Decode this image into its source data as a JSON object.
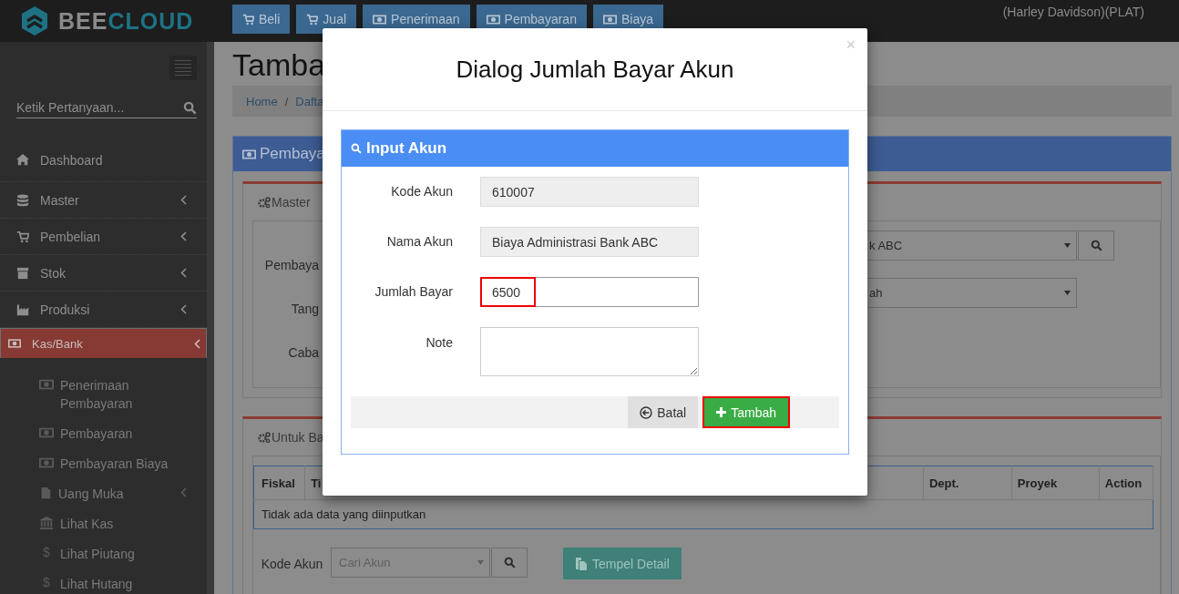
{
  "header": {
    "logo": {
      "part1": "BEE",
      "part2": "CLOUD"
    },
    "nav": [
      {
        "label": "Beli"
      },
      {
        "label": "Jual"
      },
      {
        "label": "Penerimaan"
      },
      {
        "label": "Pembayaran"
      },
      {
        "label": "Biaya"
      }
    ],
    "user": "(Harley Davidson)(PLAT)"
  },
  "sidebar": {
    "search": {
      "placeholder": "Ketik Pertanyaan..."
    },
    "items": [
      {
        "label": "Dashboard",
        "has_submenu": false,
        "selected": false
      },
      {
        "label": "Master",
        "has_submenu": true,
        "selected": false
      },
      {
        "label": "Pembelian",
        "has_submenu": true,
        "selected": false
      },
      {
        "label": "Stok",
        "has_submenu": true,
        "selected": false
      },
      {
        "label": "Produksi",
        "has_submenu": true,
        "selected": false
      },
      {
        "label": "Kas/Bank",
        "has_submenu": true,
        "selected": true
      }
    ],
    "submenu": [
      {
        "label": "Penerimaan Pembayaran",
        "has_submenu": false
      },
      {
        "label": "Pembayaran",
        "has_submenu": false
      },
      {
        "label": "Pembayaran Biaya",
        "has_submenu": false
      },
      {
        "label": "Uang Muka",
        "has_submenu": true
      },
      {
        "label": "Lihat Kas",
        "has_submenu": false
      },
      {
        "label": "Lihat Piutang",
        "symbol": "$",
        "has_submenu": false
      },
      {
        "label": "Lihat Hutang",
        "symbol": "$",
        "has_submenu": false
      }
    ]
  },
  "page": {
    "title": "Tamba",
    "breadcrumb": [
      "Home",
      "/",
      "Dafta"
    ],
    "panel_title": "Pembaya",
    "master_tab": "Master",
    "master_labels": [
      "Pembaya",
      "Tang",
      "Caba"
    ],
    "master_selects": [
      "k ABC",
      "ah"
    ],
    "detail_tab": "Untuk Ba",
    "table": {
      "columns": [
        "Fiskal",
        "Ti",
        "Dept.",
        "Proyek",
        "Action"
      ],
      "empty_text": "Tidak ada data yang diinputkan"
    },
    "kode_akun_label": "Kode Akun",
    "kode_akun_placeholder": "Cari Akun",
    "paste_button": "Tempel Detail"
  },
  "dialog": {
    "title": "Dialog Jumlah Bayar Akun",
    "close": "×",
    "panel_title": "Input Akun",
    "fields": [
      {
        "label": "Kode Akun",
        "value": "610007",
        "kind": "readonly",
        "highlighted": false
      },
      {
        "label": "Nama Akun",
        "value": "Biaya Administrasi Bank ABC",
        "kind": "readonly",
        "highlighted": false
      },
      {
        "label": "Jumlah Bayar",
        "value": "6500",
        "kind": "input",
        "highlighted": true
      },
      {
        "label": "Note",
        "kind": "textarea",
        "highlighted": false
      }
    ],
    "buttons": [
      {
        "label": "Batal",
        "kind": "cancel",
        "highlighted": false
      },
      {
        "label": "Tambah",
        "kind": "add",
        "highlighted": true
      }
    ]
  }
}
